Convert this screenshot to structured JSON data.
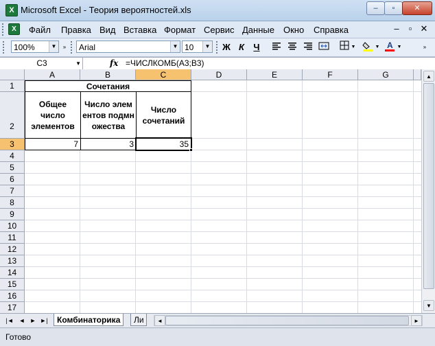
{
  "window": {
    "title": "Microsoft Excel - Теория вероятностей.xls",
    "app_icon_glyph": "X",
    "buttons": {
      "minimize": "–",
      "maximize": "▫",
      "close": "✕"
    }
  },
  "menu": {
    "items": [
      "Файл",
      "Правка",
      "Вид",
      "Вставка",
      "Формат",
      "Сервис",
      "Данные",
      "Окно",
      "Справка"
    ],
    "doc_buttons": {
      "minimize": "–",
      "restore": "▫",
      "close": "✕"
    }
  },
  "toolbar": {
    "zoom": "100%",
    "font": "Arial",
    "font_size": "10",
    "bold": "Ж",
    "italic": "К",
    "underline": "Ч",
    "fill_color": "#ffff00",
    "font_color": "#ff0000"
  },
  "formula_bar": {
    "name_box": "C3",
    "fx": "fx",
    "formula": "=ЧИСЛКОМБ(A3;B3)"
  },
  "grid": {
    "columns": [
      "A",
      "B",
      "C",
      "D",
      "E",
      "F",
      "G"
    ],
    "selected_column": "C",
    "rows": [
      "1",
      "2",
      "3",
      "4",
      "5",
      "6",
      "7",
      "8",
      "9",
      "10",
      "11",
      "12",
      "13",
      "14",
      "15",
      "16",
      "17"
    ],
    "selected_row": "3",
    "header_title": "Сочетания",
    "headers": [
      "Общее число элементов",
      "Число элементов подмножества",
      "Число сочетаний"
    ],
    "values": [
      "7",
      "3",
      "35"
    ]
  },
  "sheet_tabs": {
    "active": "Комбинаторика",
    "next_partial": "Ли"
  },
  "status": {
    "text": "Готово"
  }
}
